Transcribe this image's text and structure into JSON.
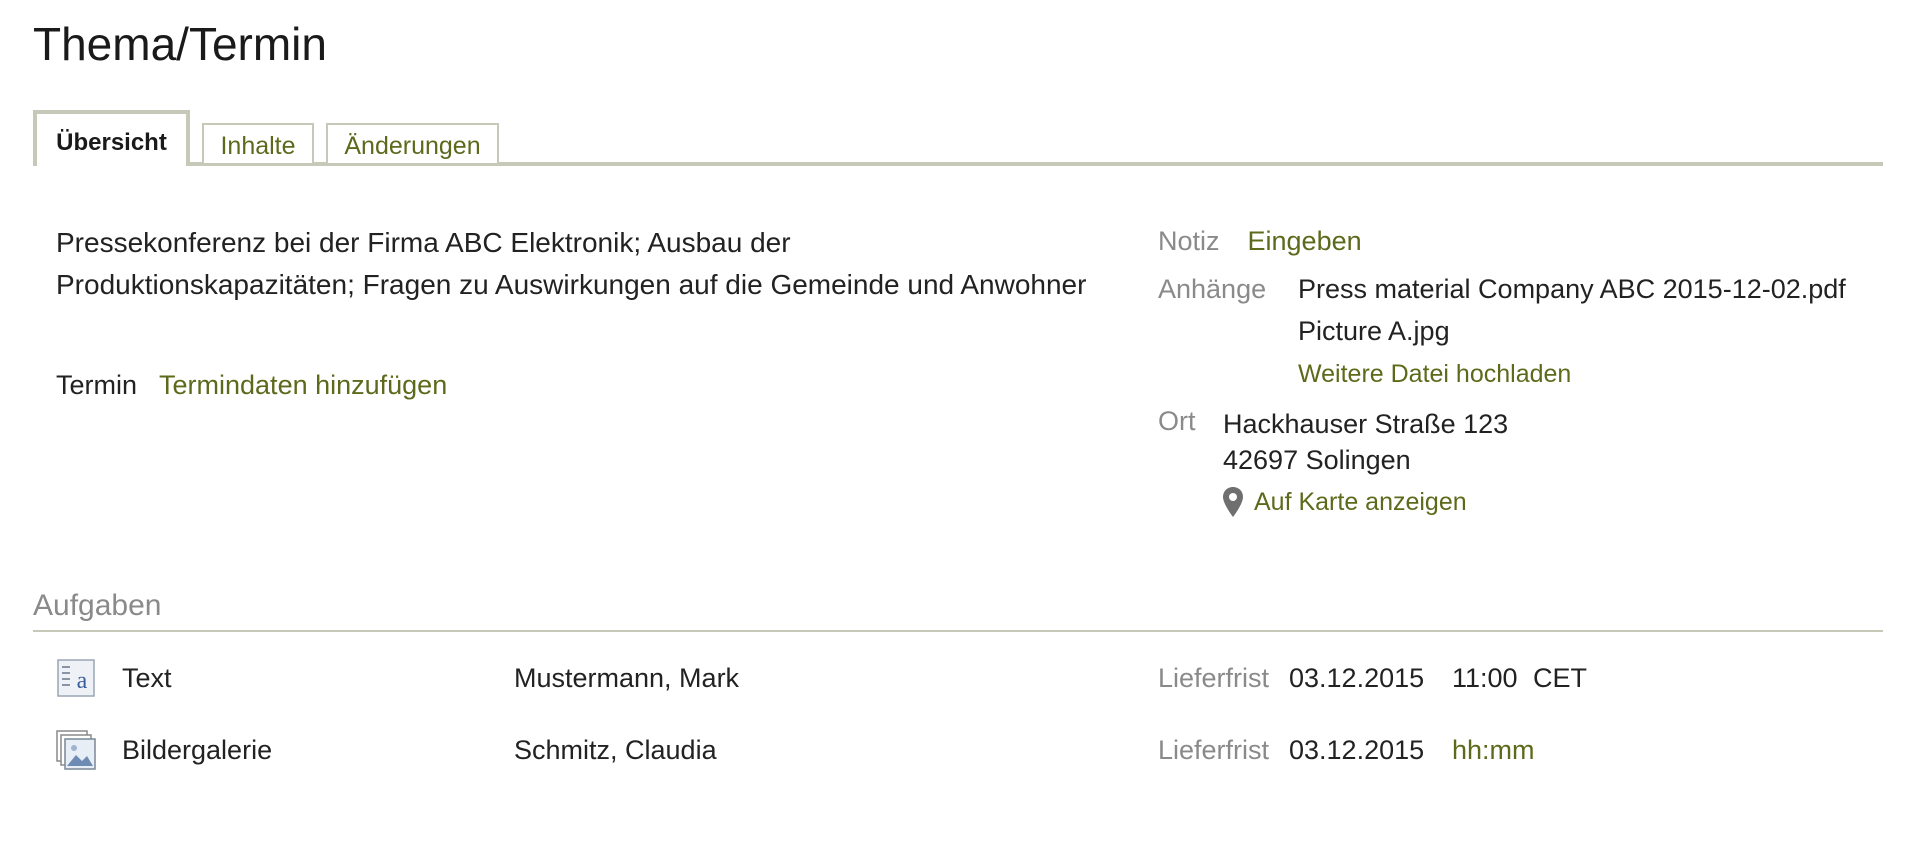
{
  "page": {
    "title": "Thema/Termin"
  },
  "tabs": [
    {
      "label": "Übersicht",
      "active": true
    },
    {
      "label": "Inhalte",
      "active": false
    },
    {
      "label": "Änderungen",
      "active": false
    }
  ],
  "overview": {
    "description": "Pressekonferenz bei der Firma ABC Elektronik; Ausbau der Produktionskapazitäten; Fragen zu Auswirkungen auf die Gemeinde und Anwohner",
    "termin_label": "Termin",
    "termin_link": "Termindaten hinzufügen",
    "notiz_label": "Notiz",
    "notiz_link": "Eingeben",
    "anhaenge_label": "Anhänge",
    "attachments": [
      "Press material Company ABC 2015-12-02.pdf",
      "Picture A.jpg"
    ],
    "upload_link": "Weitere Datei hochladen",
    "ort_label": "Ort",
    "address_line1": "Hackhauser Straße 123",
    "address_line2": "42697 Solingen",
    "map_link": "Auf Karte anzeigen",
    "map_icon": "map-pin-icon"
  },
  "tasks": {
    "title": "Aufgaben",
    "rows": [
      {
        "icon": "text-document-icon",
        "name": "Text",
        "person": "Mustermann, Mark",
        "deadline_label": "Lieferfrist",
        "date": "03.12.2015",
        "time": "11:00",
        "timezone": "CET"
      },
      {
        "icon": "image-gallery-icon",
        "name": "Bildergalerie",
        "person": "Schmitz, Claudia",
        "deadline_label": "Lieferfrist",
        "date": "03.12.2015",
        "time": "hh:mm",
        "timezone": ""
      }
    ]
  },
  "colors": {
    "link": "#5d6a1c",
    "muted": "#8a8a8a",
    "border": "#c6c8b8",
    "text": "#222222"
  }
}
